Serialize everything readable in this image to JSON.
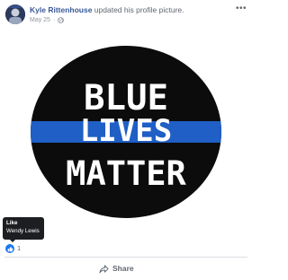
{
  "post": {
    "author_name": "Kyle Rittenhouse",
    "action_text": " updated his profile picture.",
    "date": "May 25",
    "privacy_icon": "globe-icon",
    "more_icon": "ellipsis-icon"
  },
  "image": {
    "line1": "BLUE",
    "line2": "LIVES",
    "line3": "MATTER",
    "colors": {
      "circle": "#0c0c0c",
      "stripe": "#1f5fc6",
      "text": "#ffffff"
    }
  },
  "tooltip": {
    "title": "Like",
    "name": "Wendy Lewis"
  },
  "reactions": {
    "icon": "like-icon",
    "count": "1"
  },
  "actions": {
    "share_label": "Share",
    "share_icon": "share-arrow-icon"
  },
  "colors": {
    "author_link": "#385898",
    "meta_text": "#90949c",
    "like_blue": "#1877f2"
  }
}
